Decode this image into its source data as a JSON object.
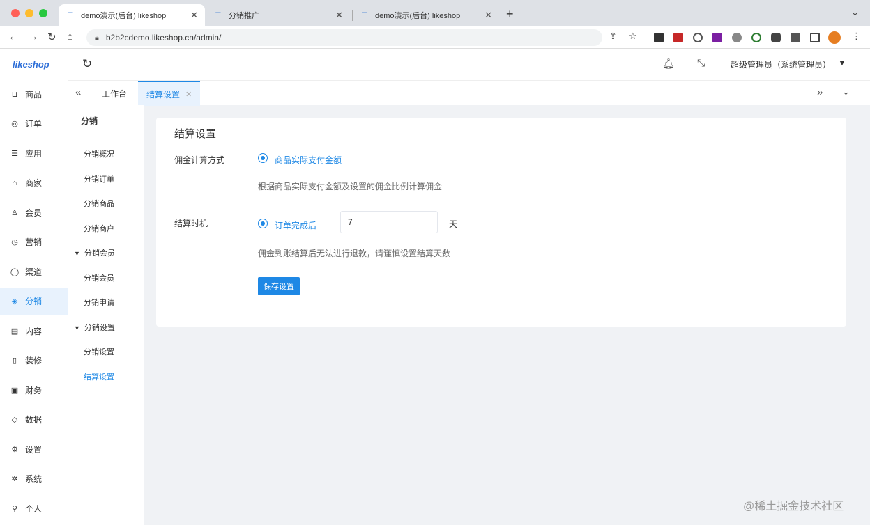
{
  "browser": {
    "tabs": [
      {
        "title": "demo演示(后台) likeshop",
        "active": true
      },
      {
        "title": "分销推广",
        "active": false
      },
      {
        "title": "demo演示(后台) likeshop",
        "active": false
      }
    ],
    "url": "b2b2cdemo.likeshop.cn/admin/"
  },
  "app": {
    "logo": "likeshop",
    "user_name": "超级管理员（系统管理员）",
    "sidebar": [
      {
        "label": "商品",
        "icon": "cart-icon"
      },
      {
        "label": "订单",
        "icon": "order-icon"
      },
      {
        "label": "应用",
        "icon": "apps-icon"
      },
      {
        "label": "商家",
        "icon": "shop-icon"
      },
      {
        "label": "会员",
        "icon": "user-icon"
      },
      {
        "label": "营销",
        "icon": "marketing-icon"
      },
      {
        "label": "渠道",
        "icon": "channel-icon"
      },
      {
        "label": "分销",
        "icon": "distribution-icon",
        "active": true
      },
      {
        "label": "内容",
        "icon": "content-icon"
      },
      {
        "label": "装修",
        "icon": "decor-icon"
      },
      {
        "label": "财务",
        "icon": "finance-icon"
      },
      {
        "label": "数据",
        "icon": "data-icon"
      },
      {
        "label": "设置",
        "icon": "settings-icon"
      },
      {
        "label": "系统",
        "icon": "system-icon"
      },
      {
        "label": "个人",
        "icon": "person-icon"
      }
    ],
    "page_tabs": [
      {
        "label": "工作台",
        "active": false
      },
      {
        "label": "结算设置",
        "active": true
      }
    ],
    "subnav": {
      "title": "分销",
      "items": [
        {
          "label": "分销概况",
          "type": "item"
        },
        {
          "label": "分销订单",
          "type": "item"
        },
        {
          "label": "分销商品",
          "type": "item"
        },
        {
          "label": "分销商户",
          "type": "item"
        },
        {
          "label": "分销会员",
          "type": "group"
        },
        {
          "label": "分销会员",
          "type": "item"
        },
        {
          "label": "分销申请",
          "type": "item"
        },
        {
          "label": "分销设置",
          "type": "group"
        },
        {
          "label": "分销设置",
          "type": "item"
        },
        {
          "label": "结算设置",
          "type": "item",
          "active": true
        }
      ]
    },
    "form": {
      "title": "结算设置",
      "commission_label": "佣金计算方式",
      "commission_option": "商品实际支付金额",
      "commission_hint": "根据商品实际支付金额及设置的佣金比例计算佣金",
      "settle_label": "结算时机",
      "settle_option": "订单完成后",
      "settle_days": "7",
      "settle_unit": "天",
      "settle_hint": "佣金到账结算后无法进行退款，请谨慎设置结算天数",
      "save_label": "保存设置"
    },
    "watermark": "@稀土掘金技术社区"
  },
  "colors": {
    "accent": "#1e88e5",
    "sidebar_active_bg": "#e8f2fd",
    "page_bg": "#f0f2f5"
  }
}
